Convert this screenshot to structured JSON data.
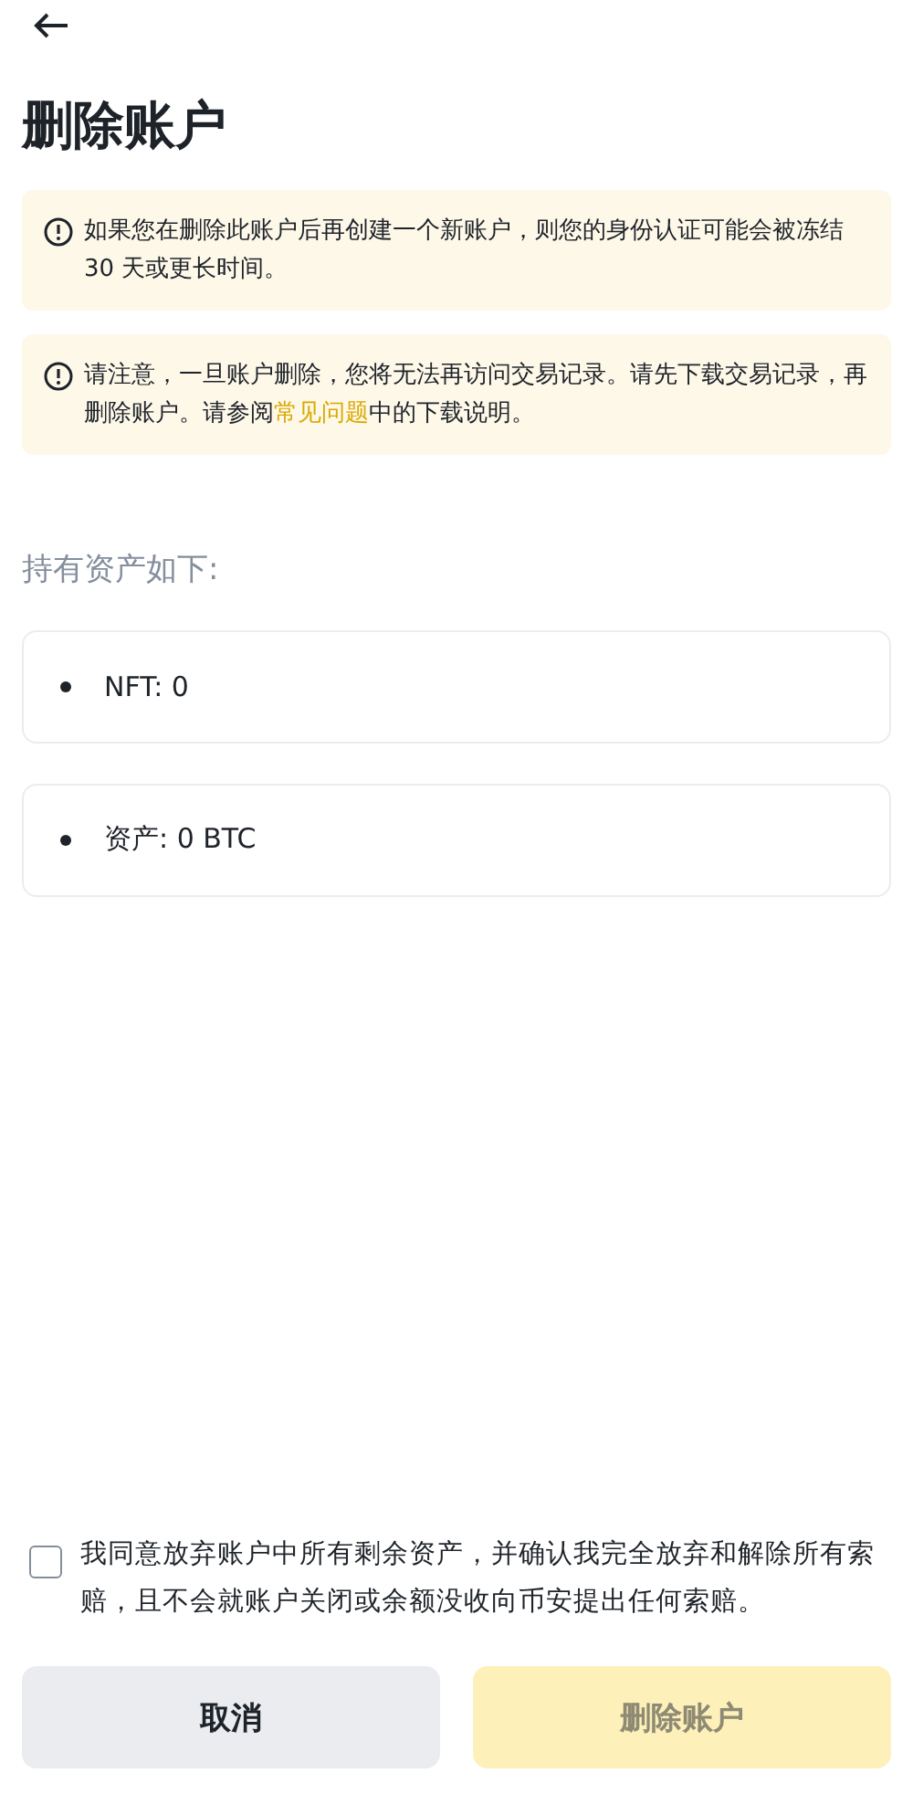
{
  "title": "删除账户",
  "notices": [
    {
      "text": "如果您在删除此账户后再创建一个新账户，则您的身份认证可能会被冻结 30 天或更长时间。"
    },
    {
      "text": "请注意，一旦账户删除，您将无法再访问交易记录。请先下载交易记录，再删除账户。请参阅",
      "link": "常见问题",
      "text_after": "中的下载说明。"
    }
  ],
  "assets_heading": "持有资产如下:",
  "assets": [
    "NFT: 0",
    "资产: 0 BTC"
  ],
  "agreement": {
    "checked": false,
    "text": "我同意放弃账户中所有剩余资产，并确认我完全放弃和解除所有索赔，且不会就账户关闭或余额没收向币安提出任何索赔。"
  },
  "buttons": [
    {
      "label": "取消",
      "kind": "secondary",
      "disabled": false
    },
    {
      "label": "删除账户",
      "kind": "primary",
      "disabled": true
    }
  ]
}
